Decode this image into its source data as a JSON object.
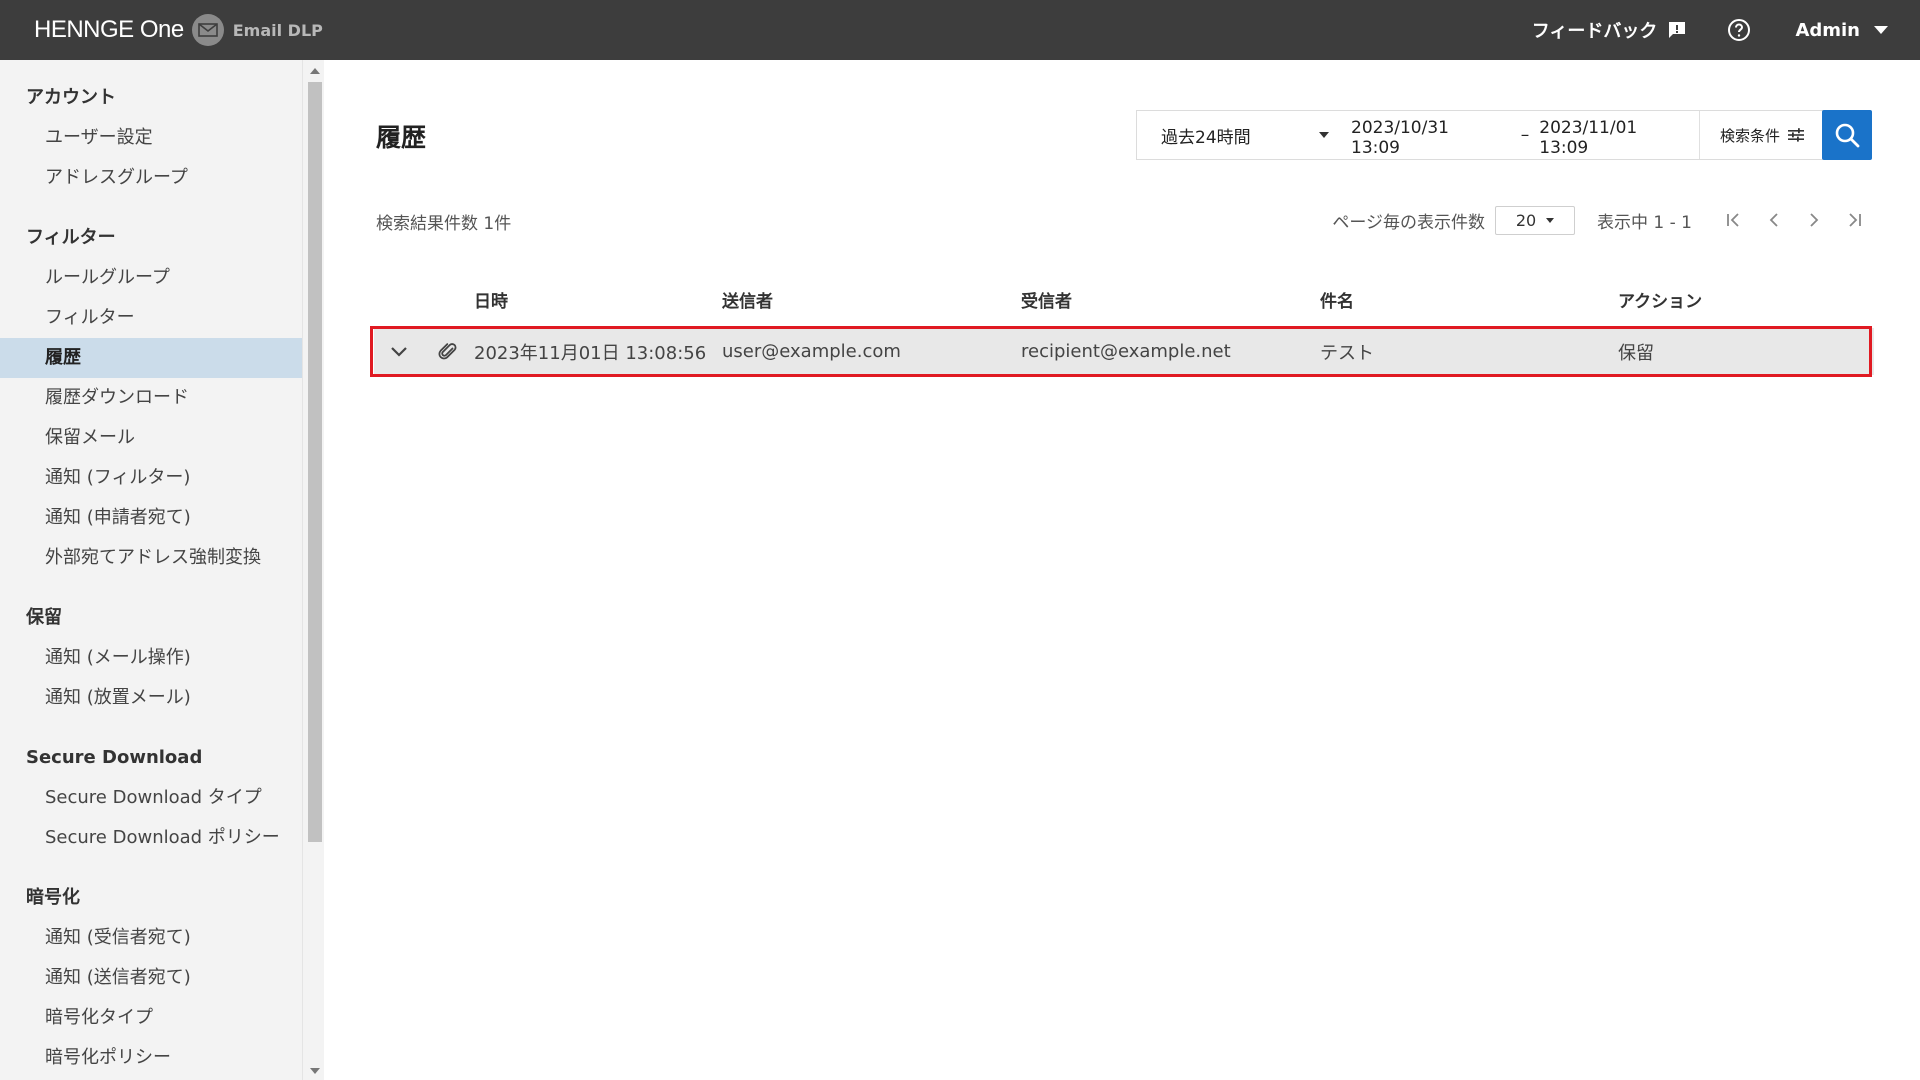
{
  "header": {
    "brand": "HENNGE One",
    "product": "Email DLP",
    "feedback_label": "フィードバック",
    "user_label": "Admin"
  },
  "sidebar": {
    "sections": [
      {
        "title": "アカウント",
        "items": [
          "ユーザー設定",
          "アドレスグループ"
        ]
      },
      {
        "title": "フィルター",
        "items": [
          "ルールグループ",
          "フィルター",
          "履歴",
          "履歴ダウンロード",
          "保留メール",
          "通知 (フィルター)",
          "通知 (申請者宛て)",
          "外部宛てアドレス強制変換"
        ]
      },
      {
        "title": "保留",
        "items": [
          "通知 (メール操作)",
          "通知 (放置メール)"
        ]
      },
      {
        "title": "Secure Download",
        "items": [
          "Secure Download タイプ",
          "Secure Download ポリシー"
        ]
      },
      {
        "title": "暗号化",
        "items": [
          "通知 (受信者宛て)",
          "通知 (送信者宛て)",
          "暗号化タイプ",
          "暗号化ポリシー"
        ]
      }
    ],
    "active_item": "履歴"
  },
  "main": {
    "title": "履歴",
    "filter": {
      "period": "過去24時間",
      "from": "2023/10/31　13:09",
      "separator": "–",
      "to": "2023/11/01　13:09",
      "conditions_label": "検索条件"
    },
    "result_count": "検索結果件数 1件",
    "pager": {
      "per_page_label": "ページ毎の表示件数",
      "per_page_value": "20",
      "range_label": "表示中 1 - 1"
    },
    "table": {
      "columns": [
        "日時",
        "送信者",
        "受信者",
        "件名",
        "アクション"
      ],
      "rows": [
        {
          "date": "2023年11月01日 13:08:56",
          "sender": "user@example.com",
          "recipient": "recipient@example.net",
          "subject": "テスト",
          "action": "保留"
        }
      ]
    }
  },
  "colors": {
    "topbar": "#3d3d3d",
    "sidebar_bg": "#f3f3f3",
    "active_item_bg": "#cbdcea",
    "accent": "#1a73c9",
    "highlight_outline": "#e01a22",
    "row_bg": "#e8e8e8"
  },
  "icons": {
    "logo": "mail-icon",
    "feedback": "feedback-icon",
    "help": "help-circle-icon",
    "conditions": "tune-icon",
    "search": "search-icon",
    "expand": "chevron-down-icon",
    "attachment": "paperclip-icon",
    "pager": [
      "first-page-icon",
      "prev-page-icon",
      "next-page-icon",
      "last-page-icon"
    ]
  }
}
